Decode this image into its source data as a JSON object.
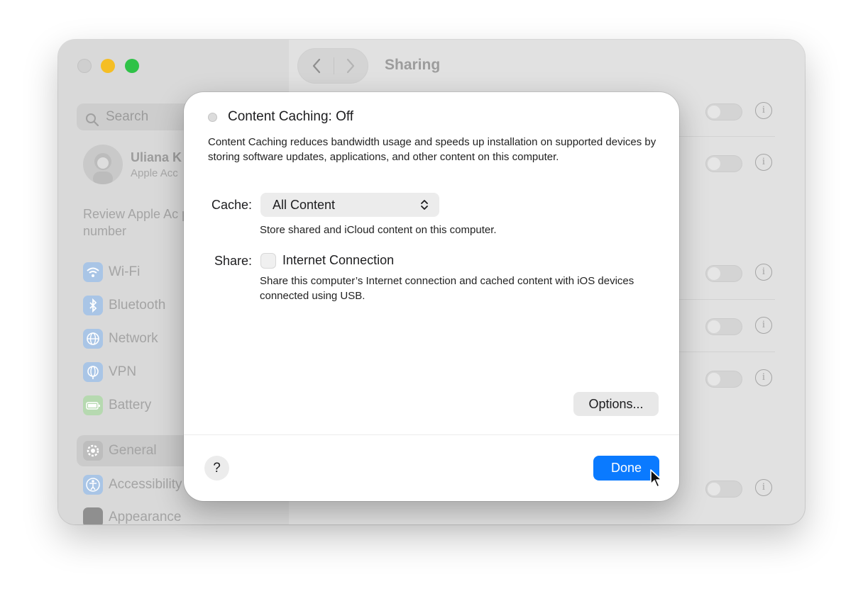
{
  "window": {
    "toolbar_title": "Sharing"
  },
  "sidebar": {
    "search_placeholder": "Search",
    "account": {
      "name": "Uliana K",
      "subtitle": "Apple Acc"
    },
    "review_text": "Review Apple Ac phone number",
    "items": [
      {
        "label": "Wi-Fi",
        "icon": "wifi-icon",
        "color": "#a9c5e6"
      },
      {
        "label": "Bluetooth",
        "icon": "bluetooth-icon",
        "color": "#a9c5e6"
      },
      {
        "label": "Network",
        "icon": "globe-icon",
        "color": "#a9c5e6"
      },
      {
        "label": "VPN",
        "icon": "vpn-globe-icon",
        "color": "#a9c5e6"
      },
      {
        "label": "Battery",
        "icon": "battery-icon",
        "color": "#b6d9b0"
      },
      {
        "label": "General",
        "icon": "gear-icon",
        "color": "#bdbdbd",
        "selected": true
      },
      {
        "label": "Accessibility",
        "icon": "accessibility-icon",
        "color": "#a9c5e6"
      },
      {
        "label": "Appearance",
        "icon": "appearance-icon",
        "color": "#8f8f8f"
      }
    ]
  },
  "sheet": {
    "status_title": "Content Caching: Off",
    "description": "Content Caching reduces bandwidth usage and speeds up installation on supported devices by storing software updates, applications, and other content on this computer.",
    "cache": {
      "label": "Cache:",
      "selected": "All Content",
      "help_text": "Store shared and iCloud content on this computer."
    },
    "share": {
      "label": "Share:",
      "checkbox_label": "Internet Connection",
      "checked": false,
      "help_text": "Share this computer’s Internet connection and cached content with iOS devices connected using USB."
    },
    "options_label": "Options...",
    "help_label": "?",
    "done_label": "Done",
    "accent": "#0a7aff"
  }
}
